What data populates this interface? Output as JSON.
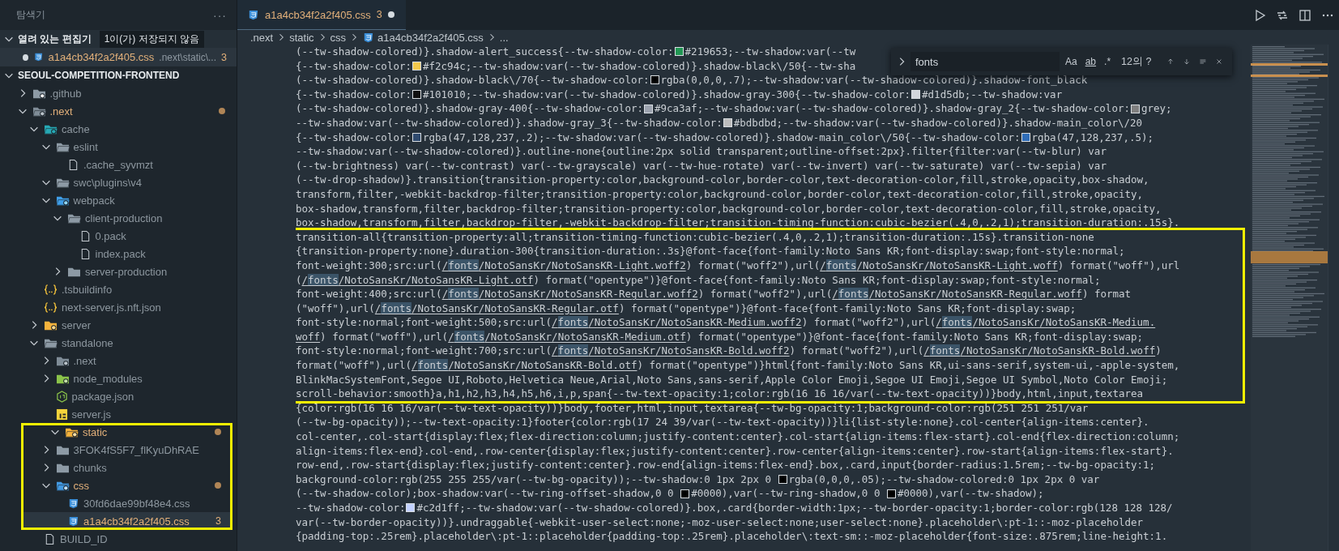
{
  "sidebar": {
    "title": "탐색기",
    "more": "···",
    "open_editors": {
      "title": "열려 있는 편집기",
      "badge": "1이(가) 저장되지 않음",
      "expanded": true,
      "items": [
        {
          "name": "a1a4cb34f2a2f405.css",
          "path": ".next\\static\\...",
          "count": "3",
          "dirty": true,
          "color": "#e2b07a"
        }
      ]
    },
    "project": {
      "title": "SEOUL-COMPETITION-FRONTEND",
      "expanded": true
    },
    "tree": [
      {
        "name": ".github",
        "kind": "folder-github",
        "color": "#8d979f",
        "expanded": false,
        "dot": false,
        "selected": false,
        "boxed": false
      },
      {
        "name": ".next",
        "kind": "folder-next",
        "color": "#e2b07a",
        "expanded": true,
        "dot": true,
        "selected": false,
        "boxed": false,
        "children": [
          {
            "name": "cache",
            "kind": "folder-cache",
            "color": "#8d979f",
            "expanded": true,
            "dot": false,
            "selected": false,
            "boxed": false,
            "children": [
              {
                "name": "eslint",
                "kind": "folder",
                "color": "#8d979f",
                "expanded": true,
                "dot": false,
                "selected": false,
                "boxed": false,
                "children": [
                  {
                    "name": ".cache_syvmzt",
                    "kind": "file",
                    "color": "#8d979f",
                    "dot": false,
                    "selected": false,
                    "boxed": false
                  }
                ]
              },
              {
                "name": "swc\\plugins\\v4",
                "kind": "folder",
                "color": "#8d979f",
                "expanded": true,
                "dot": false,
                "selected": false,
                "boxed": false
              },
              {
                "name": "webpack",
                "kind": "folder-webpack",
                "color": "#8d979f",
                "expanded": true,
                "dot": false,
                "selected": false,
                "boxed": false,
                "children": [
                  {
                    "name": "client-production",
                    "kind": "folder",
                    "color": "#8d979f",
                    "expanded": true,
                    "dot": false,
                    "selected": false,
                    "boxed": false,
                    "children": [
                      {
                        "name": "0.pack",
                        "kind": "file",
                        "color": "#8d979f",
                        "dot": false,
                        "selected": false,
                        "boxed": false
                      },
                      {
                        "name": "index.pack",
                        "kind": "file",
                        "color": "#8d979f",
                        "dot": false,
                        "selected": false,
                        "boxed": false
                      }
                    ]
                  },
                  {
                    "name": "server-production",
                    "kind": "folder",
                    "color": "#8d979f",
                    "expanded": false,
                    "dot": false,
                    "selected": false,
                    "boxed": false
                  }
                ]
              }
            ]
          },
          {
            "name": ".tsbuildinfo",
            "kind": "json",
            "color": "#8d979f",
            "dot": false,
            "selected": false,
            "boxed": false
          },
          {
            "name": "next-server.js.nft.json",
            "kind": "json",
            "color": "#8d979f",
            "dot": false,
            "selected": false,
            "boxed": false
          },
          {
            "name": "server",
            "kind": "folder-server",
            "color": "#8d979f",
            "expanded": false,
            "dot": false,
            "selected": false,
            "boxed": false
          },
          {
            "name": "standalone",
            "kind": "folder",
            "color": "#8d979f",
            "expanded": true,
            "dot": false,
            "selected": false,
            "boxed": false,
            "children": [
              {
                "name": ".next",
                "kind": "folder-next",
                "color": "#8d979f",
                "expanded": false,
                "dot": false,
                "selected": false,
                "boxed": false
              },
              {
                "name": "node_modules",
                "kind": "folder-node",
                "color": "#8d979f",
                "expanded": false,
                "dot": false,
                "selected": false,
                "boxed": false
              },
              {
                "name": "package.json",
                "kind": "nodejs",
                "color": "#8d979f",
                "dot": false,
                "selected": false,
                "boxed": false
              },
              {
                "name": "server.js",
                "kind": "js",
                "color": "#8d979f",
                "dot": false,
                "selected": false,
                "boxed": false
              }
            ]
          },
          {
            "name": "static",
            "kind": "folder-static",
            "color": "#e2b07a",
            "expanded": true,
            "dot": true,
            "selected": false,
            "boxed": true,
            "children": [
              {
                "name": "3FOK4fS5F7_flKyuDhRAE",
                "kind": "folder",
                "color": "#8d979f",
                "expanded": false,
                "dot": false,
                "selected": false,
                "boxed": false
              },
              {
                "name": "chunks",
                "kind": "folder",
                "color": "#8d979f",
                "expanded": false,
                "dot": false,
                "selected": false,
                "boxed": false
              },
              {
                "name": "css",
                "kind": "folder-css",
                "color": "#e2b07a",
                "expanded": true,
                "dot": true,
                "selected": false,
                "boxed": false,
                "children": [
                  {
                    "name": "30fd6dae99bf48e4.css",
                    "kind": "css",
                    "color": "#8d979f",
                    "dot": false,
                    "selected": false,
                    "boxed": false
                  },
                  {
                    "name": "a1a4cb34f2a2f405.css",
                    "kind": "css",
                    "color": "#e2b07a",
                    "dot": false,
                    "badge": "3",
                    "selected": true,
                    "boxed": false
                  }
                ]
              }
            ]
          },
          {
            "name": "BUILD_ID",
            "kind": "file",
            "color": "#8d979f",
            "dot": false,
            "selected": false,
            "boxed": false
          }
        ]
      }
    ]
  },
  "tabs": [
    {
      "name": "a1a4cb34f2a2f405.css",
      "count": "3",
      "dirty": true,
      "selected": true
    }
  ],
  "breadcrumb": [
    {
      "kind": "text",
      "label": ".next"
    },
    {
      "kind": "text",
      "label": "static"
    },
    {
      "kind": "text",
      "label": "css"
    },
    {
      "kind": "css",
      "label": "a1a4cb34f2a2f405.css"
    },
    {
      "kind": "text",
      "label": "..."
    }
  ],
  "find": {
    "value": "fonts",
    "options": [
      {
        "label": "Aa",
        "on": false
      },
      {
        "label": "ab",
        "on": false
      },
      {
        "label": ".*",
        "on": false
      }
    ],
    "count": "12의 ?"
  },
  "blocks": [
    {
      "boxed": false,
      "lines": [
        {
          "parts": [
            {
              "kind": "text",
              "text": "(--tw-shadow-colored)}.shadow-alert_success{--tw-shadow-color:"
            },
            {
              "kind": "swatch",
              "color": "#219653"
            },
            {
              "kind": "text",
              "text": "#219653;--tw-shadow:var(--tw"
            }
          ]
        },
        {
          "parts": [
            {
              "kind": "text",
              "text": "{--tw-shadow-color:"
            },
            {
              "kind": "swatch",
              "color": "#f2c94c"
            },
            {
              "kind": "text",
              "text": "#f2c94c;--tw-shadow:var(--tw-shadow-colored)}.shadow-black\\/50{--tw-sha"
            }
          ]
        },
        {
          "parts": [
            {
              "kind": "text",
              "text": "(--tw-shadow-colored)}.shadow-black\\/70{--tw-shadow-color:"
            },
            {
              "kind": "swatch",
              "color": "#000000"
            },
            {
              "kind": "text",
              "text": "rgba(0,0,0,.7);--tw-shadow:var(--tw-shadow-colored)}.shadow-font_black"
            }
          ]
        },
        {
          "parts": [
            {
              "kind": "text",
              "text": "{--tw-shadow-color:"
            },
            {
              "kind": "swatch",
              "color": "#101010"
            },
            {
              "kind": "text",
              "text": "#101010;--tw-shadow:var(--tw-shadow-colored)}.shadow-gray-300{--tw-shadow-color:"
            },
            {
              "kind": "swatch",
              "color": "#d1d5db"
            },
            {
              "kind": "text",
              "text": "#d1d5db;--tw-shadow:var"
            }
          ]
        },
        {
          "parts": [
            {
              "kind": "text",
              "text": "(--tw-shadow-colored)}.shadow-gray-400{--tw-shadow-color:"
            },
            {
              "kind": "swatch",
              "color": "#9ca3af"
            },
            {
              "kind": "text",
              "text": "#9ca3af;--tw-shadow:var(--tw-shadow-colored)}.shadow-gray_2{--tw-shadow-color:"
            },
            {
              "kind": "swatch",
              "color": "#808080"
            },
            {
              "kind": "text",
              "text": "grey;"
            }
          ]
        },
        {
          "parts": [
            {
              "kind": "text",
              "text": "--tw-shadow:var(--tw-shadow-colored)}.shadow-gray_3{--tw-shadow-color:"
            },
            {
              "kind": "swatch",
              "color": "#bdbdbd"
            },
            {
              "kind": "text",
              "text": "#bdbdbd;--tw-shadow:var(--tw-shadow-colored)}.shadow-main_color\\/20"
            }
          ]
        },
        {
          "parts": [
            {
              "kind": "text",
              "text": "{--tw-shadow-color:"
            },
            {
              "kind": "swatch",
              "color": "#2f4a6e"
            },
            {
              "kind": "text",
              "text": "rgba(47,128,237,.2);--tw-shadow:var(--tw-shadow-colored)}.shadow-main_color\\/50{--tw-shadow-color:"
            },
            {
              "kind": "swatch",
              "color": "#2f6db8"
            },
            {
              "kind": "text",
              "text": "rgba(47,128,237,.5);"
            }
          ]
        },
        {
          "parts": [
            {
              "kind": "text",
              "text": "--tw-shadow:var(--tw-shadow-colored)}.outline-none{outline:2px solid transparent;outline-offset:2px}.filter{filter:var(--tw-blur) var"
            }
          ]
        },
        {
          "parts": [
            {
              "kind": "text",
              "text": "(--tw-brightness) var(--tw-contrast) var(--tw-grayscale) var(--tw-hue-rotate) var(--tw-invert) var(--tw-saturate) var(--tw-sepia) var"
            }
          ]
        },
        {
          "parts": [
            {
              "kind": "text",
              "text": "(--tw-drop-shadow)}.transition{transition-property:color,background-color,border-color,text-decoration-color,fill,stroke,opacity,box-shadow,"
            }
          ]
        },
        {
          "parts": [
            {
              "kind": "text",
              "text": "transform,filter,-webkit-backdrop-filter;transition-property:color,background-color,border-color,text-decoration-color,fill,stroke,opacity,"
            }
          ]
        },
        {
          "parts": [
            {
              "kind": "text",
              "text": "box-shadow,transform,filter,backdrop-filter;transition-property:color,background-color,border-color,text-decoration-color,fill,stroke,opacity,"
            }
          ]
        },
        {
          "parts": [
            {
              "kind": "text",
              "text": "box-shadow,transform,filter,backdrop-filter,-webkit-backdrop-filter;transition-timing-function:cubic-bezier(.4,0,.2,1);transition-duration:.15s}."
            }
          ]
        }
      ]
    },
    {
      "boxed": true,
      "lines": [
        {
          "parts": [
            {
              "kind": "text",
              "text": "transition-all{transition-property:all;transition-timing-function:cubic-bezier(.4,0,.2,1);transition-duration:.15s}.transition-none"
            }
          ]
        },
        {
          "parts": [
            {
              "kind": "text",
              "text": "{transition-property:none}.duration-300{transition-duration:.3s}@font-face{font-family:Noto Sans KR;font-display:swap;font-style:normal;"
            }
          ]
        },
        {
          "parts": [
            {
              "kind": "text",
              "text": "font-weight:300;src:url("
            },
            {
              "kind": "link",
              "prefix": "/",
              "match": "fonts",
              "rest": "/NotoSansKr/NotoSansKR-Light.woff2"
            },
            {
              "kind": "text",
              "text": ") format(\"woff2\"),url("
            },
            {
              "kind": "link",
              "prefix": "/",
              "match": "fonts",
              "rest": "/NotoSansKr/NotoSansKR-Light.woff"
            },
            {
              "kind": "text",
              "text": ") format(\"woff\"),url"
            }
          ]
        },
        {
          "parts": [
            {
              "kind": "text",
              "text": "("
            },
            {
              "kind": "link",
              "prefix": "/",
              "match": "fonts",
              "rest": "/NotoSansKr/NotoSansKR-Light.otf"
            },
            {
              "kind": "text",
              "text": ") format(\"opentype\")}@font-face{font-family:Noto Sans KR;font-display:swap;font-style:normal;"
            }
          ]
        },
        {
          "parts": [
            {
              "kind": "text",
              "text": "font-weight:400;src:url("
            },
            {
              "kind": "link",
              "prefix": "/",
              "match": "fonts",
              "rest": "/NotoSansKr/NotoSansKR-Regular.woff2"
            },
            {
              "kind": "text",
              "text": ") format(\"woff2\"),url("
            },
            {
              "kind": "link",
              "prefix": "/",
              "match": "fonts",
              "rest": "/NotoSansKr/NotoSansKR-Regular.woff"
            },
            {
              "kind": "text",
              "text": ") format"
            }
          ]
        },
        {
          "parts": [
            {
              "kind": "text",
              "text": "(\"woff\"),url("
            },
            {
              "kind": "link",
              "prefix": "/",
              "match": "fonts",
              "rest": "/NotoSansKr/NotoSansKR-Regular.otf"
            },
            {
              "kind": "text",
              "text": ") format(\"opentype\")}@font-face{font-family:Noto Sans KR;font-display:swap;"
            }
          ]
        },
        {
          "parts": [
            {
              "kind": "text",
              "text": "font-style:normal;font-weight:500;src:url("
            },
            {
              "kind": "link",
              "prefix": "/",
              "match": "fonts",
              "rest": "/NotoSansKr/NotoSansKR-Medium.woff2"
            },
            {
              "kind": "text",
              "text": ") format(\"woff2\"),url("
            },
            {
              "kind": "link",
              "prefix": "/",
              "match": "fonts",
              "rest": "/NotoSansKr/NotoSansKR-Medium."
            }
          ]
        },
        {
          "parts": [
            {
              "kind": "link",
              "rest": "woff"
            },
            {
              "kind": "text",
              "text": ") format(\"woff\"),url("
            },
            {
              "kind": "link",
              "prefix": "/",
              "match": "fonts",
              "rest": "/NotoSansKr/NotoSansKR-Medium.otf"
            },
            {
              "kind": "text",
              "text": ") format(\"opentype\")}@font-face{font-family:Noto Sans KR;font-display:swap;"
            }
          ]
        },
        {
          "parts": [
            {
              "kind": "text",
              "text": "font-style:normal;font-weight:700;src:url("
            },
            {
              "kind": "link",
              "prefix": "/",
              "match": "fonts",
              "rest": "/NotoSansKr/NotoSansKR-Bold.woff2"
            },
            {
              "kind": "text",
              "text": ") format(\"woff2\"),url("
            },
            {
              "kind": "link",
              "prefix": "/",
              "match": "fonts",
              "rest": "/NotoSansKr/NotoSansKR-Bold.woff"
            },
            {
              "kind": "text",
              "text": ")"
            }
          ]
        },
        {
          "parts": [
            {
              "kind": "text",
              "text": "format(\"woff\"),url("
            },
            {
              "kind": "link",
              "prefix": "/",
              "match": "fonts",
              "rest": "/NotoSansKr/NotoSansKR-Bold.otf"
            },
            {
              "kind": "text",
              "text": ") format(\"opentype\")}html{font-family:Noto Sans KR,ui-sans-serif,system-ui,-apple-system,"
            }
          ]
        },
        {
          "parts": [
            {
              "kind": "text",
              "text": "BlinkMacSystemFont,Segoe UI,Roboto,Helvetica Neue,Arial,Noto Sans,sans-serif,Apple Color Emoji,Segoe UI Emoji,Segoe UI Symbol,Noto Color Emoji;"
            }
          ]
        },
        {
          "parts": [
            {
              "kind": "text",
              "text": "scroll-behavior:smooth}a,h1,h2,h3,h4,h5,h6,i,p,span{--tw-text-opacity:1;color:rgb(16 16 16/var(--tw-text-opacity))}body,html,input,textarea"
            }
          ]
        }
      ]
    },
    {
      "boxed": false,
      "lines": [
        {
          "parts": [
            {
              "kind": "text",
              "text": "{color:rgb(16 16 16/var(--tw-text-opacity))}body,footer,html,input,textarea{--tw-bg-opacity:1;background-color:rgb(251 251 251/var"
            }
          ]
        },
        {
          "parts": [
            {
              "kind": "text",
              "text": "(--tw-bg-opacity));--tw-text-opacity:1}footer{color:rgb(17 24 39/var(--tw-text-opacity))}li{list-style:none}.col-center{align-items:center}."
            }
          ]
        },
        {
          "parts": [
            {
              "kind": "text",
              "text": "col-center,.col-start{display:flex;flex-direction:column;justify-content:center}.col-start{align-items:flex-start}.col-end{flex-direction:column;"
            }
          ]
        },
        {
          "parts": [
            {
              "kind": "text",
              "text": "align-items:flex-end}.col-end,.row-center{display:flex;justify-content:center}.row-center{align-items:center}.row-start{align-items:flex-start}."
            }
          ]
        },
        {
          "parts": [
            {
              "kind": "text",
              "text": "row-end,.row-start{display:flex;justify-content:center}.row-end{align-items:flex-end}.box,.card,input{border-radius:1.5rem;--tw-bg-opacity:1;"
            }
          ]
        },
        {
          "parts": [
            {
              "kind": "text",
              "text": "background-color:rgb(255 255 255/var(--tw-bg-opacity));--tw-shadow:0 1px 2px 0 "
            },
            {
              "kind": "swatch",
              "color": "#000000"
            },
            {
              "kind": "text",
              "text": "rgba(0,0,0,.05);--tw-shadow-colored:0 1px 2px 0 var"
            }
          ]
        },
        {
          "parts": [
            {
              "kind": "text",
              "text": "(--tw-shadow-color);box-shadow:var(--tw-ring-offset-shadow,0 0 "
            },
            {
              "kind": "swatch",
              "color": "#000000"
            },
            {
              "kind": "text",
              "text": "#0000),var(--tw-ring-shadow,0 0 "
            },
            {
              "kind": "swatch",
              "color": "#000000"
            },
            {
              "kind": "text",
              "text": "#0000),var(--tw-shadow);"
            }
          ]
        },
        {
          "parts": [
            {
              "kind": "text",
              "text": "--tw-shadow-color:"
            },
            {
              "kind": "swatch",
              "color": "#c2d1ff"
            },
            {
              "kind": "text",
              "text": "#c2d1ff;--tw-shadow:var(--tw-shadow-colored)}.box,.card{border-width:1px;--tw-border-opacity:1;border-color:rgb(128 128 128/"
            }
          ]
        },
        {
          "parts": [
            {
              "kind": "text",
              "text": "var(--tw-border-opacity))}.undraggable{-webkit-user-select:none;-moz-user-select:none;user-select:none}.placeholder\\:pt-1::-moz-placeholder"
            }
          ]
        },
        {
          "parts": [
            {
              "kind": "text",
              "text": "{padding-top:.25rem}.placeholder\\:pt-1::placeholder{padding-top:.25rem}.placeholder\\:text-sm::-moz-placeholder{font-size:.875rem;line-height:1."
            }
          ]
        }
      ]
    }
  ]
}
